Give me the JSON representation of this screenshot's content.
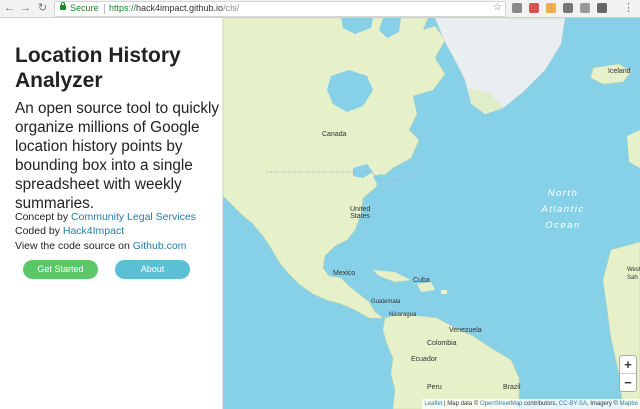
{
  "browser": {
    "secure_label": "Secure",
    "url_scheme": "https://",
    "url_host": "hack4impact.github.io",
    "url_path": "/cls/"
  },
  "sidebar": {
    "title": "Location History Analyzer",
    "description": "An open source tool to quickly organize millions of Google location history points by bounding box into a single spreadsheet with weekly summaries.",
    "concept_prefix": "Concept by ",
    "concept_link": "Community Legal Services",
    "coded_prefix": "Coded by ",
    "coded_link": "Hack4Impact",
    "source_prefix": "View the code source on ",
    "source_link": "Github.com",
    "get_started_label": "Get Started",
    "about_label": "About"
  },
  "map": {
    "labels": {
      "canada": "Canada",
      "iceland": "Iceland",
      "us_line1": "United",
      "us_line2": "States",
      "mexico": "Mexico",
      "cuba": "Cuba",
      "guatemala": "Guatemala",
      "nicaragua": "Nicaragua",
      "venezuela": "Venezuela",
      "colombia": "Colombia",
      "ecuador": "Ecuador",
      "peru": "Peru",
      "brazil": "Brazil",
      "western_sahara": "Weste Sah",
      "ocean_line1": "North",
      "ocean_line2": "Atlantic",
      "ocean_line3": "Ocean"
    },
    "zoom_in": "+",
    "zoom_out": "−",
    "attribution": {
      "leaflet": "Leaflet",
      "text1": " | Map data © ",
      "osm": "OpenStreetMap",
      "text2": " contributors, ",
      "license": "CC-BY-SA",
      "text3": ", Imagery © ",
      "mapbox": "Mapbo"
    }
  }
}
